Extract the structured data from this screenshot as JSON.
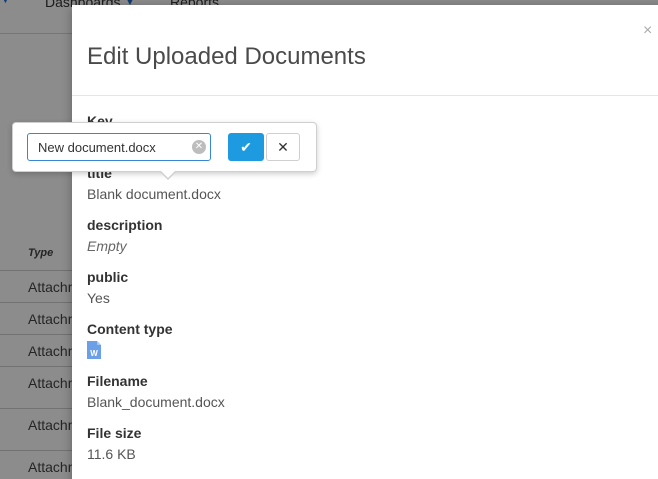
{
  "background": {
    "nav": [
      {
        "label": "Dashboards"
      },
      {
        "label": "Reports"
      }
    ],
    "table": {
      "type_header": "Type",
      "rows": [
        "Attachment",
        "Attachment",
        "Attachment",
        "Attachment",
        "Attachment",
        "Attachment"
      ]
    }
  },
  "modal": {
    "title": "Edit Uploaded Documents",
    "close_symbol": "×",
    "fields": {
      "key_label": "Key",
      "title_label": "title",
      "title_value": "Blank document.docx",
      "description_label": "description",
      "description_value": "Empty",
      "public_label": "public",
      "public_value": "Yes",
      "content_type_label": "Content type",
      "content_type_icon": "word-document-icon",
      "filename_label": "Filename",
      "filename_value": "Blank_document.docx",
      "file_size_label": "File size",
      "file_size_value": "11.6 KB"
    }
  },
  "popover": {
    "input_value": "New document.docx",
    "clear_symbol": "✕",
    "save_symbol": "✔",
    "cancel_symbol": "✕"
  },
  "colors": {
    "accent": "#1e9be0",
    "word_icon": "#6b9fe8"
  }
}
